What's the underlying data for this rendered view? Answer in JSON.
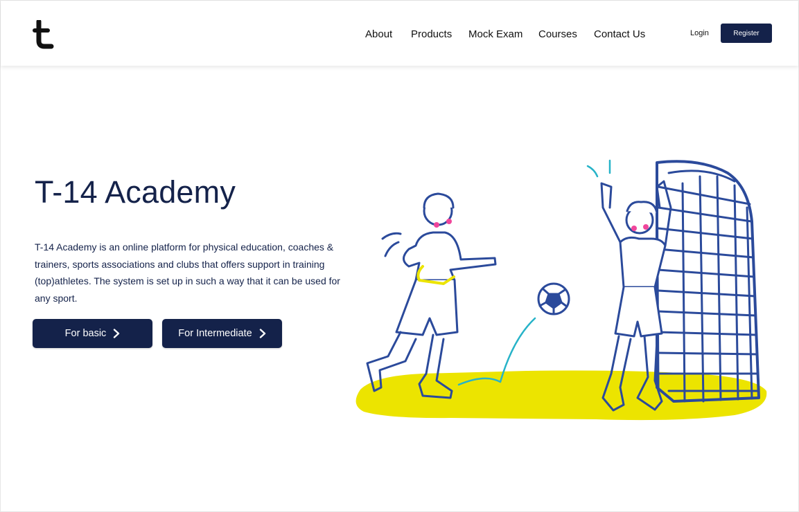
{
  "nav": {
    "links": [
      "About",
      "Products",
      "Mock Exam",
      "Courses",
      "Contact Us"
    ],
    "login_label": "Login",
    "register_label": "Register"
  },
  "hero": {
    "title": "T-14 Academy",
    "description": "T-14 Academy is an online platform for physical education, coaches & trainers, sports associations and clubs that offers support in training (top)athletes. The system is set up in such a way that it can be used for any sport.",
    "buttons": [
      {
        "label": "For basic",
        "icon": "chevron-right-icon"
      },
      {
        "label": "For Intermediate",
        "icon": "chevron-right-icon"
      }
    ]
  },
  "icons": {
    "logo": "t-logo-icon",
    "illustration": "soccer-players-illustration"
  },
  "colors": {
    "brand_navy": "#14224a",
    "illustration_stroke": "#2b4a9b",
    "illustration_yellow": "#ece400",
    "illustration_cyan": "#27b3c8",
    "cheek_pink": "#f0469b"
  }
}
